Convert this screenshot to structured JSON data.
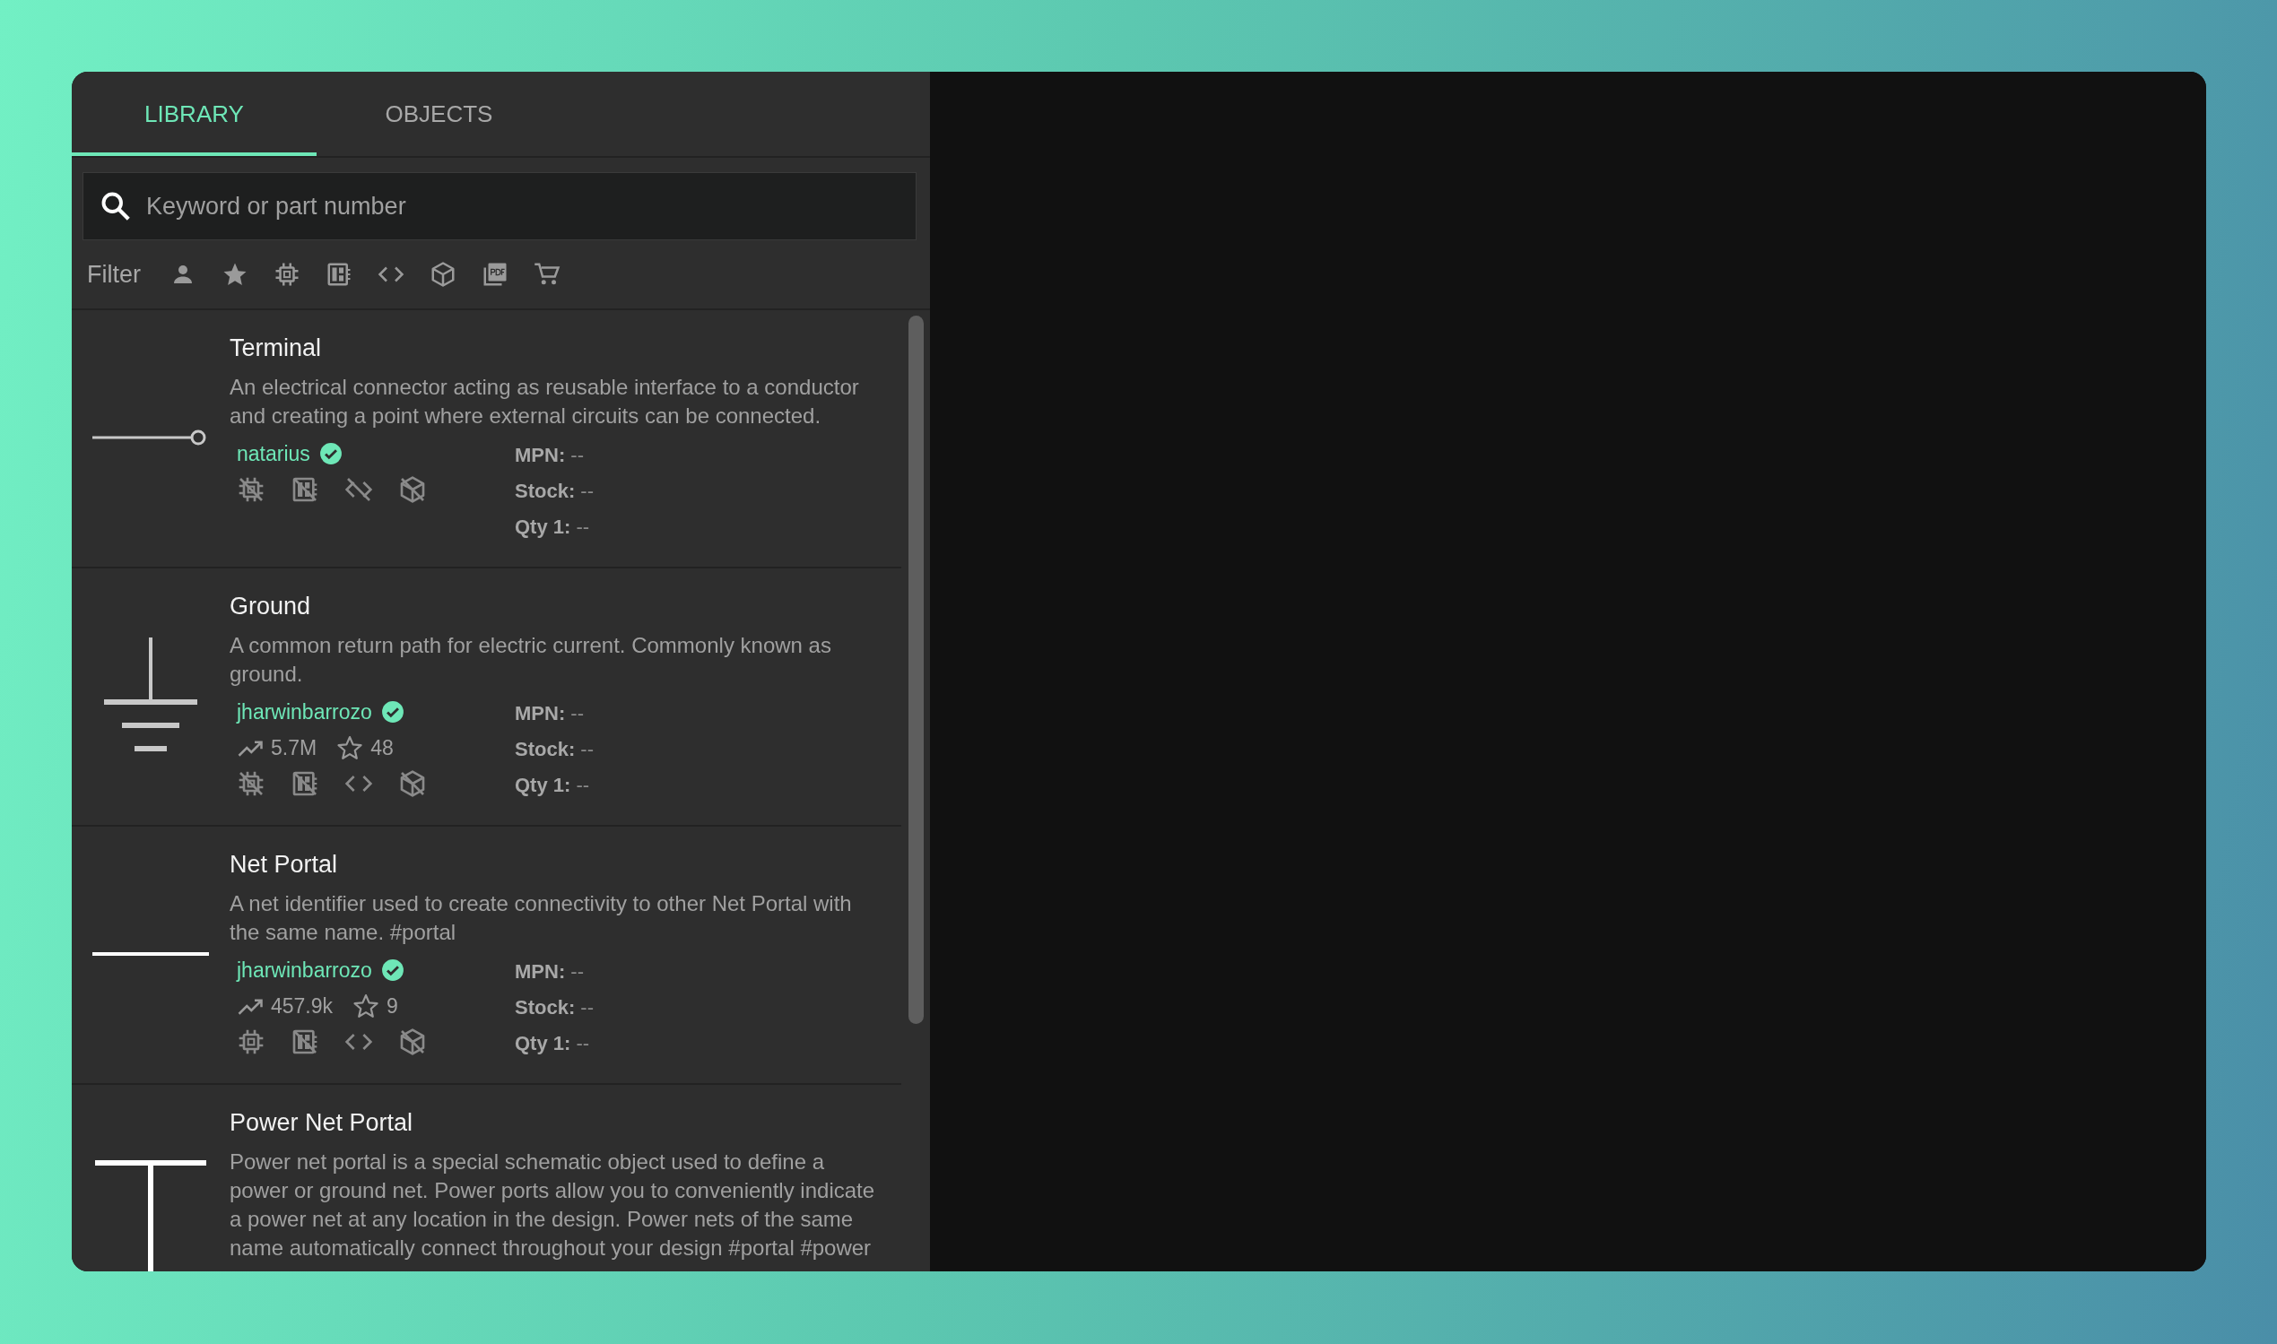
{
  "tabs": [
    {
      "label": "LIBRARY",
      "selected": true
    },
    {
      "label": "OBJECTS",
      "selected": false
    }
  ],
  "search": {
    "placeholder": "Keyword or part number"
  },
  "filter": {
    "label": "Filter"
  },
  "items": [
    {
      "title": "Terminal",
      "kind": "terminal",
      "description": "An electrical connector acting as reusable interface to a conductor and creating a point where external circuits can be connected.",
      "author": "natarius",
      "verified": true,
      "features": [
        {
          "kind": "chip",
          "available": false
        },
        {
          "kind": "footprint",
          "available": false
        },
        {
          "kind": "code",
          "available": false
        },
        {
          "kind": "cube",
          "available": false
        }
      ],
      "mpn_label": "MPN:",
      "mpn": "--",
      "stock_label": "Stock:",
      "stock": "--",
      "qty_label": "Qty 1:",
      "qty": "--"
    },
    {
      "title": "Ground",
      "kind": "ground",
      "description": "A common return path for electric current. Commonly known as ground.",
      "author": "jharwinbarrozo",
      "verified": true,
      "uses": "5.7M",
      "star_count": "48",
      "features": [
        {
          "kind": "chip",
          "available": false
        },
        {
          "kind": "footprint",
          "available": false
        },
        {
          "kind": "code",
          "available": true
        },
        {
          "kind": "cube",
          "available": false
        }
      ],
      "mpn_label": "MPN:",
      "mpn": "--",
      "stock_label": "Stock:",
      "stock": "--",
      "qty_label": "Qty 1:",
      "qty": "--"
    },
    {
      "title": "Net Portal",
      "kind": "net",
      "description": "A net identifier used to create connectivity to other Net Portal with the same name. #portal",
      "author": "jharwinbarrozo",
      "verified": true,
      "uses": "457.9k",
      "star_count": "9",
      "features": [
        {
          "kind": "chip",
          "available": true
        },
        {
          "kind": "footprint",
          "available": false
        },
        {
          "kind": "code",
          "available": true
        },
        {
          "kind": "cube",
          "available": false
        }
      ],
      "mpn_label": "MPN:",
      "mpn": "--",
      "stock_label": "Stock:",
      "stock": "--",
      "qty_label": "Qty 1:",
      "qty": "--"
    },
    {
      "title": "Power Net Portal",
      "kind": "power",
      "description": "Power net portal is a special schematic object used to define a power or ground net. Power ports allow you to conveniently indicate a power net at any location in the design. Power nets of the same name automatically connect throughout your design #portal #power"
    }
  ]
}
